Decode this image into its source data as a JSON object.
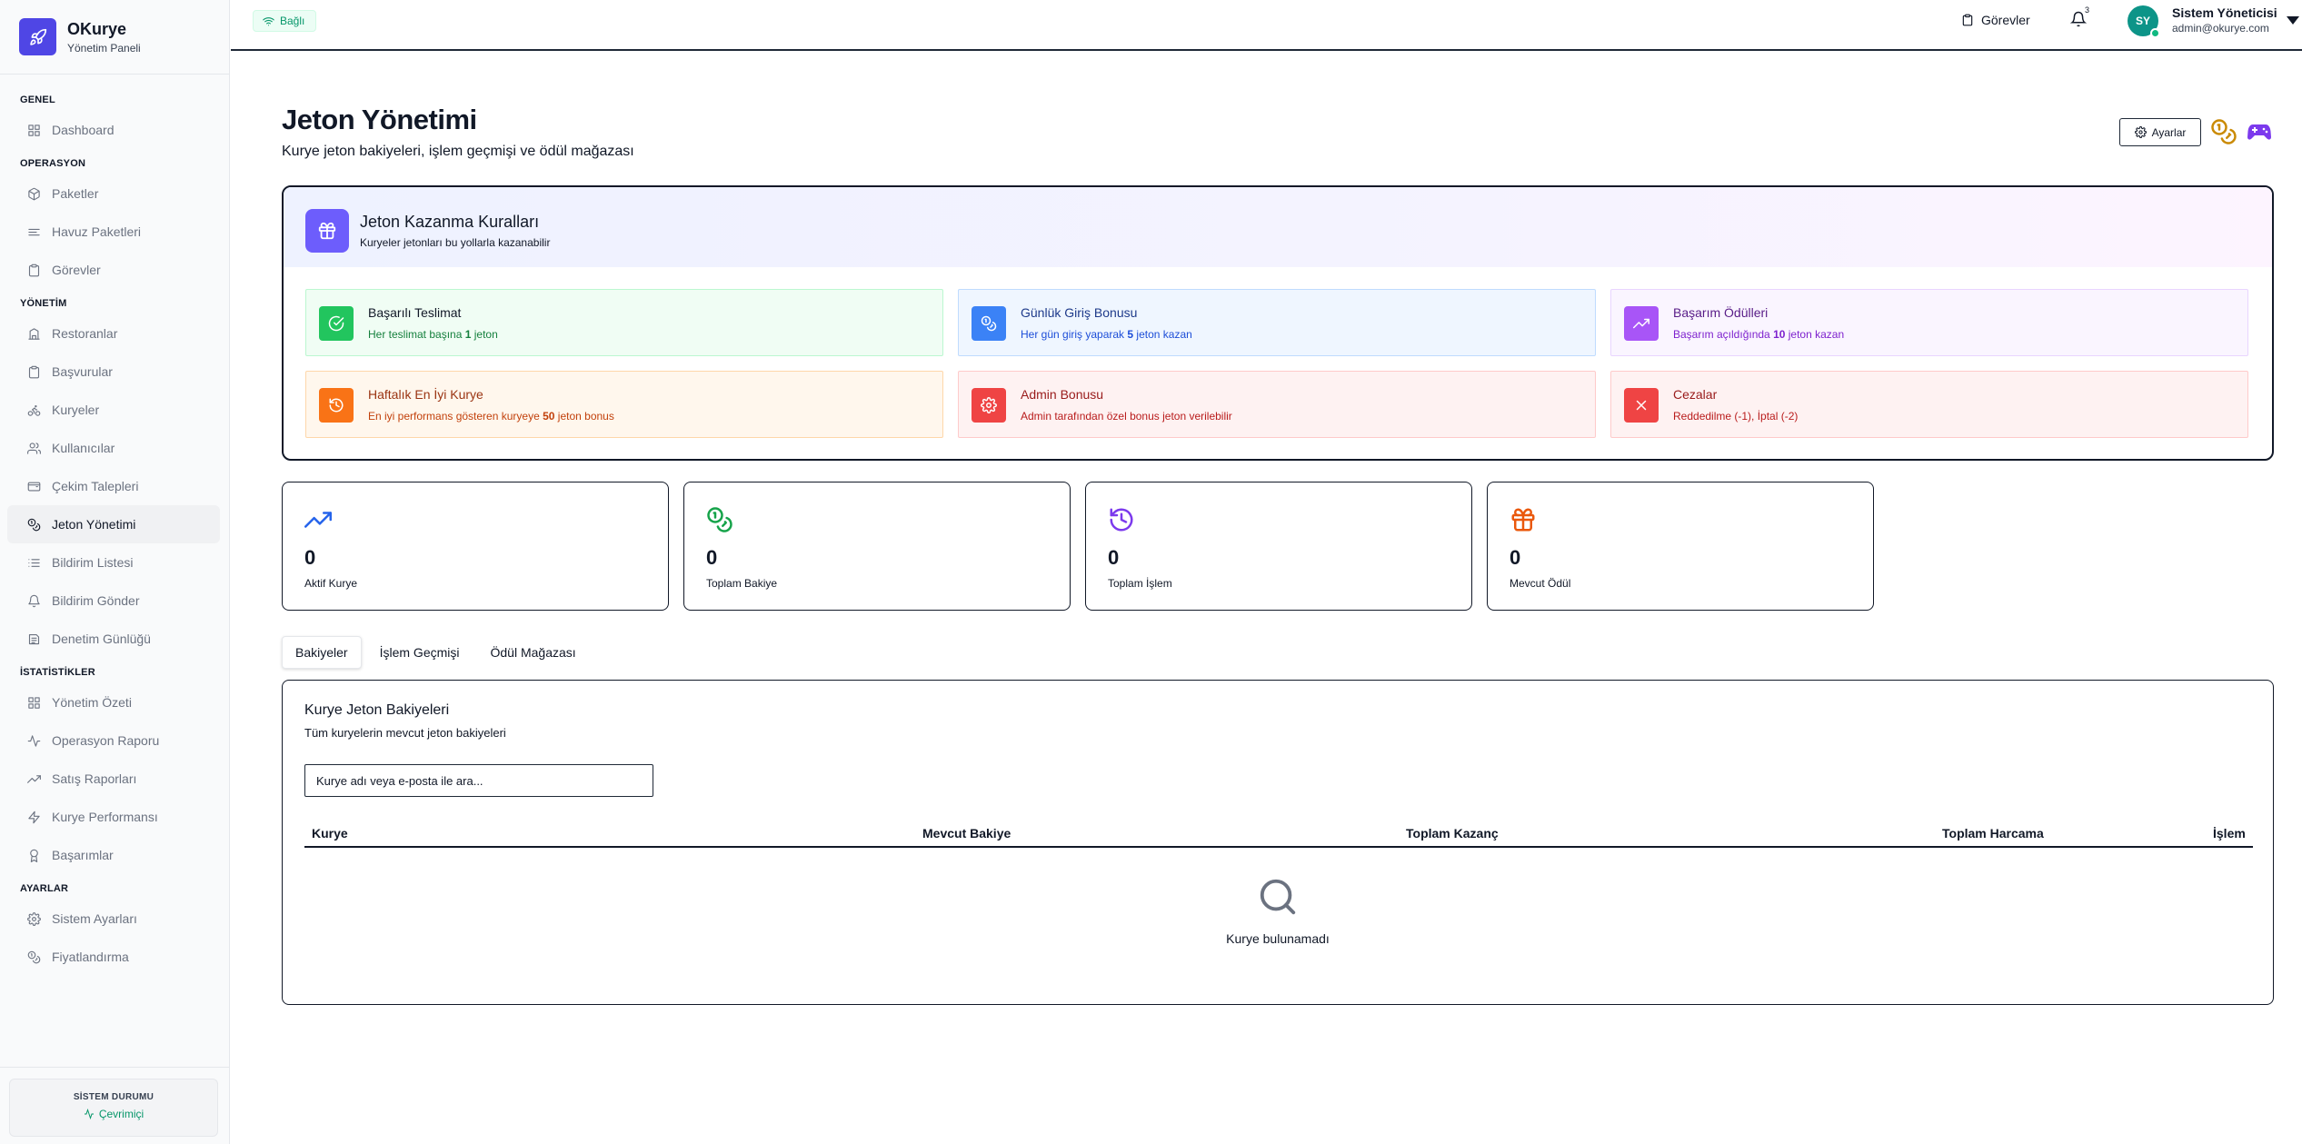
{
  "brand": {
    "title": "OKurye",
    "subtitle": "Yönetim Paneli"
  },
  "sidebar": {
    "sections": [
      {
        "title": "GENEL",
        "items": [
          {
            "label": "Dashboard",
            "icon": "grid-icon"
          }
        ]
      },
      {
        "title": "OPERASYON",
        "items": [
          {
            "label": "Paketler",
            "icon": "package-icon"
          },
          {
            "label": "Havuz Paketleri",
            "icon": "layers-icon"
          },
          {
            "label": "Görevler",
            "icon": "clipboard-icon"
          }
        ]
      },
      {
        "title": "YÖNETİM",
        "items": [
          {
            "label": "Restoranlar",
            "icon": "building-icon"
          },
          {
            "label": "Başvurular",
            "icon": "clipboard-icon"
          },
          {
            "label": "Kuryeler",
            "icon": "bike-icon"
          },
          {
            "label": "Kullanıcılar",
            "icon": "users-icon"
          },
          {
            "label": "Çekim Talepleri",
            "icon": "wallet-icon"
          },
          {
            "label": "Jeton Yönetimi",
            "icon": "coins-icon",
            "active": true
          },
          {
            "label": "Bildirim Listesi",
            "icon": "list-icon"
          },
          {
            "label": "Bildirim Gönder",
            "icon": "bell-icon"
          },
          {
            "label": "Denetim Günlüğü",
            "icon": "log-icon"
          }
        ]
      },
      {
        "title": "İSTATİSTİKLER",
        "items": [
          {
            "label": "Yönetim Özeti",
            "icon": "grid-icon"
          },
          {
            "label": "Operasyon Raporu",
            "icon": "activity-icon"
          },
          {
            "label": "Satış Raporları",
            "icon": "trending-icon"
          },
          {
            "label": "Kurye Performansı",
            "icon": "zap-icon"
          },
          {
            "label": "Başarımlar",
            "icon": "award-icon"
          }
        ]
      },
      {
        "title": "AYARLAR",
        "items": [
          {
            "label": "Sistem Ayarları",
            "icon": "gear-icon"
          },
          {
            "label": "Fiyatlandırma",
            "icon": "coins-icon"
          }
        ]
      }
    ],
    "status_title": "SİSTEM DURUMU",
    "status_value": "Çevrimiçi"
  },
  "header": {
    "connection": "Bağlı",
    "tasks_label": "Görevler",
    "notification_count": "3",
    "avatar_initials": "SY",
    "user_name": "Sistem Yöneticisi",
    "user_email": "admin@okurye.com"
  },
  "page": {
    "title": "Jeton Yönetimi",
    "subtitle": "Kurye jeton bakiyeleri, işlem geçmişi ve ödül mağazası",
    "settings_label": "Ayarlar"
  },
  "rules": {
    "title": "Jeton Kazanma Kuralları",
    "subtitle": "Kuryeler jetonları bu yollarla kazanabilir",
    "items": [
      {
        "title": "Başarılı Teslimat",
        "desc_pre": "Her teslimat başına ",
        "desc_bold": "1",
        "desc_post": " jeton",
        "theme": "green",
        "icon": "check-circle-icon"
      },
      {
        "title": "Günlük Giriş Bonusu",
        "desc_pre": "Her gün giriş yaparak ",
        "desc_bold": "5",
        "desc_post": " jeton kazan",
        "theme": "blue",
        "icon": "coins-icon"
      },
      {
        "title": "Başarım Ödülleri",
        "desc_pre": "Başarım açıldığında ",
        "desc_bold": "10",
        "desc_post": " jeton kazan",
        "theme": "purple",
        "icon": "trending-icon"
      },
      {
        "title": "Haftalık En İyi Kurye",
        "desc_pre": "En iyi performans gösteren kuryeye ",
        "desc_bold": "50",
        "desc_post": " jeton bonus",
        "theme": "orange",
        "icon": "history-icon"
      },
      {
        "title": "Admin Bonusu",
        "desc_pre": "Admin tarafından özel bonus jeton verilebilir",
        "desc_bold": "",
        "desc_post": "",
        "theme": "red",
        "icon": "gear-icon"
      },
      {
        "title": "Cezalar",
        "desc_pre": "Reddedilme (-1), İptal (-2)",
        "desc_bold": "",
        "desc_post": "",
        "theme": "red",
        "icon": "x-icon"
      }
    ]
  },
  "stats": [
    {
      "value": "0",
      "label": "Aktif Kurye",
      "icon": "trending-icon",
      "color": "#2563eb"
    },
    {
      "value": "0",
      "label": "Toplam Bakiye",
      "icon": "coins-icon",
      "color": "#16a34a"
    },
    {
      "value": "0",
      "label": "Toplam İşlem",
      "icon": "history-icon",
      "color": "#7c3aed"
    },
    {
      "value": "0",
      "label": "Mevcut Ödül",
      "icon": "gift-icon",
      "color": "#ea580c"
    }
  ],
  "tabs": [
    {
      "label": "Bakiyeler",
      "active": true
    },
    {
      "label": "İşlem Geçmişi",
      "active": false
    },
    {
      "label": "Ödül Mağazası",
      "active": false
    }
  ],
  "balances": {
    "title": "Kurye Jeton Bakiyeleri",
    "subtitle": "Tüm kuryelerin mevcut jeton bakiyeleri",
    "search_placeholder": "Kurye adı veya e-posta ile ara...",
    "columns": [
      "Kurye",
      "Mevcut Bakiye",
      "Toplam Kazanç",
      "Toplam Harcama",
      "İşlem"
    ],
    "empty_text": "Kurye bulunamadı"
  },
  "colors": {
    "accent": "#4f46e5",
    "online": "#059669"
  }
}
